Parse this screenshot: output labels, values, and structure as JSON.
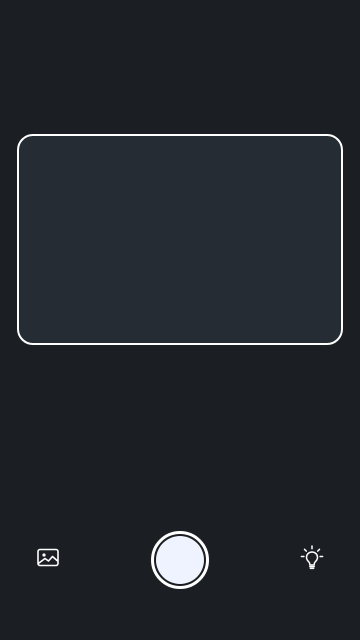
{
  "camera": {
    "viewfinder": {},
    "controls": {
      "gallery_icon": "image-icon",
      "shutter_icon": "shutter-button",
      "flash_icon": "lightbulb-icon"
    }
  },
  "colors": {
    "background": "#1b1e22",
    "viewfinder_fill": "#262c34",
    "frame_border": "#ffffff",
    "shutter_fill": "#eef3ff"
  }
}
